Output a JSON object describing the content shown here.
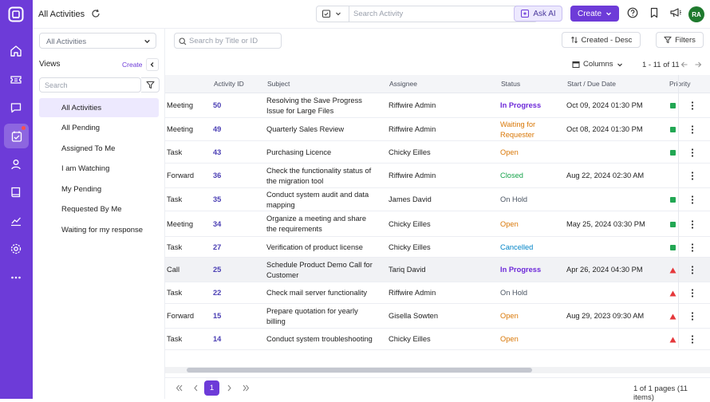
{
  "topbar": {
    "title": "All Activities",
    "search_placeholder": "Search Activity",
    "ask_ai_label": "Ask AI",
    "create_label": "Create",
    "avatar_initials": "RA"
  },
  "left": {
    "filter_select": "All Activities",
    "views_title": "Views",
    "views_create": "Create",
    "search_placeholder": "Search",
    "items": [
      {
        "label": "All Activities",
        "active": true
      },
      {
        "label": "All Pending"
      },
      {
        "label": "Assigned To Me"
      },
      {
        "label": "I am Watching"
      },
      {
        "label": "My Pending"
      },
      {
        "label": "Requested By Me"
      },
      {
        "label": "Waiting for my response"
      }
    ]
  },
  "toolbar": {
    "search_placeholder": "Search by Title or ID",
    "sort_label": "Created - Desc",
    "filters_label": "Filters",
    "columns_label": "Columns",
    "page_info": "1 - 11 of 11"
  },
  "table": {
    "headers": [
      "Activity ID",
      "Subject",
      "Assignee",
      "Status",
      "Start / Due Date",
      "Priority"
    ],
    "rows": [
      {
        "type": "Meeting",
        "id": "50",
        "subject": [
          "Resolving the Save Progress",
          "Issue for Large Files"
        ],
        "assignee": "Riffwire Admin",
        "status": [
          "In Progress"
        ],
        "status_color": "#6d28d9",
        "date": "Oct 09, 2024 01:30 PM",
        "priority": "green"
      },
      {
        "type": "Meeting",
        "id": "49",
        "subject": [
          "Quarterly Sales Review"
        ],
        "assignee": "Riffwire Admin",
        "status": [
          "Waiting for",
          "Requester"
        ],
        "status_color": "#d97706",
        "date": "Oct 08, 2024 01:30 PM",
        "priority": "green"
      },
      {
        "type": "Task",
        "id": "43",
        "subject": [
          "Purchasing Licence"
        ],
        "assignee": "Chicky Eilles",
        "status": [
          "Open"
        ],
        "status_color": "#d97706",
        "date": "",
        "priority": "green"
      },
      {
        "type": "Forward",
        "id": "36",
        "subject": [
          "Check the functionality status of",
          "the migration tool"
        ],
        "assignee": "Riffwire Admin",
        "status": [
          "Closed"
        ],
        "status_color": "#16a34a",
        "date": "Aug 22, 2024 02:30 AM",
        "priority": "none"
      },
      {
        "type": "Task",
        "id": "35",
        "subject": [
          "Conduct system audit and data",
          "mapping"
        ],
        "assignee": "James David",
        "status": [
          "On Hold"
        ],
        "status_color": "#4b5563",
        "date": "",
        "priority": "green"
      },
      {
        "type": "Meeting",
        "id": "34",
        "subject": [
          "Organize a meeting and share",
          "the requirements"
        ],
        "assignee": "Chicky Eilles",
        "status": [
          "Open"
        ],
        "status_color": "#d97706",
        "date": "May 25, 2024 03:30 PM",
        "priority": "green"
      },
      {
        "type": "Task",
        "id": "27",
        "subject": [
          "Verification of product license"
        ],
        "assignee": "Chicky Eilles",
        "status": [
          "Cancelled"
        ],
        "status_color": "#0284c7",
        "date": "",
        "priority": "green"
      },
      {
        "type": "Call",
        "id": "25",
        "subject": [
          "Schedule Product Demo Call for",
          "Customer"
        ],
        "assignee": "Tariq David",
        "status": [
          "In Progress"
        ],
        "status_color": "#6d28d9",
        "date": "Apr 26, 2024 04:30 PM",
        "priority": "red",
        "highlight": true
      },
      {
        "type": "Task",
        "id": "22",
        "subject": [
          "Check mail server functionality"
        ],
        "assignee": "Riffwire Admin",
        "status": [
          "On Hold"
        ],
        "status_color": "#4b5563",
        "date": "",
        "priority": "red"
      },
      {
        "type": "Forward",
        "id": "15",
        "subject": [
          "Prepare quotation for yearly",
          "billing"
        ],
        "assignee": "Gisella Sowten",
        "status": [
          "Open"
        ],
        "status_color": "#d97706",
        "date": "Aug 29, 2023 09:30 AM",
        "priority": "red"
      },
      {
        "type": "Task",
        "id": "14",
        "subject": [
          "Conduct system troubleshooting"
        ],
        "assignee": "Chicky Eilles",
        "status": [
          "Open"
        ],
        "status_color": "#d97706",
        "date": "",
        "priority": "red"
      }
    ]
  },
  "pager": {
    "current": "1",
    "info": "1 of 1 pages (11 items)"
  }
}
